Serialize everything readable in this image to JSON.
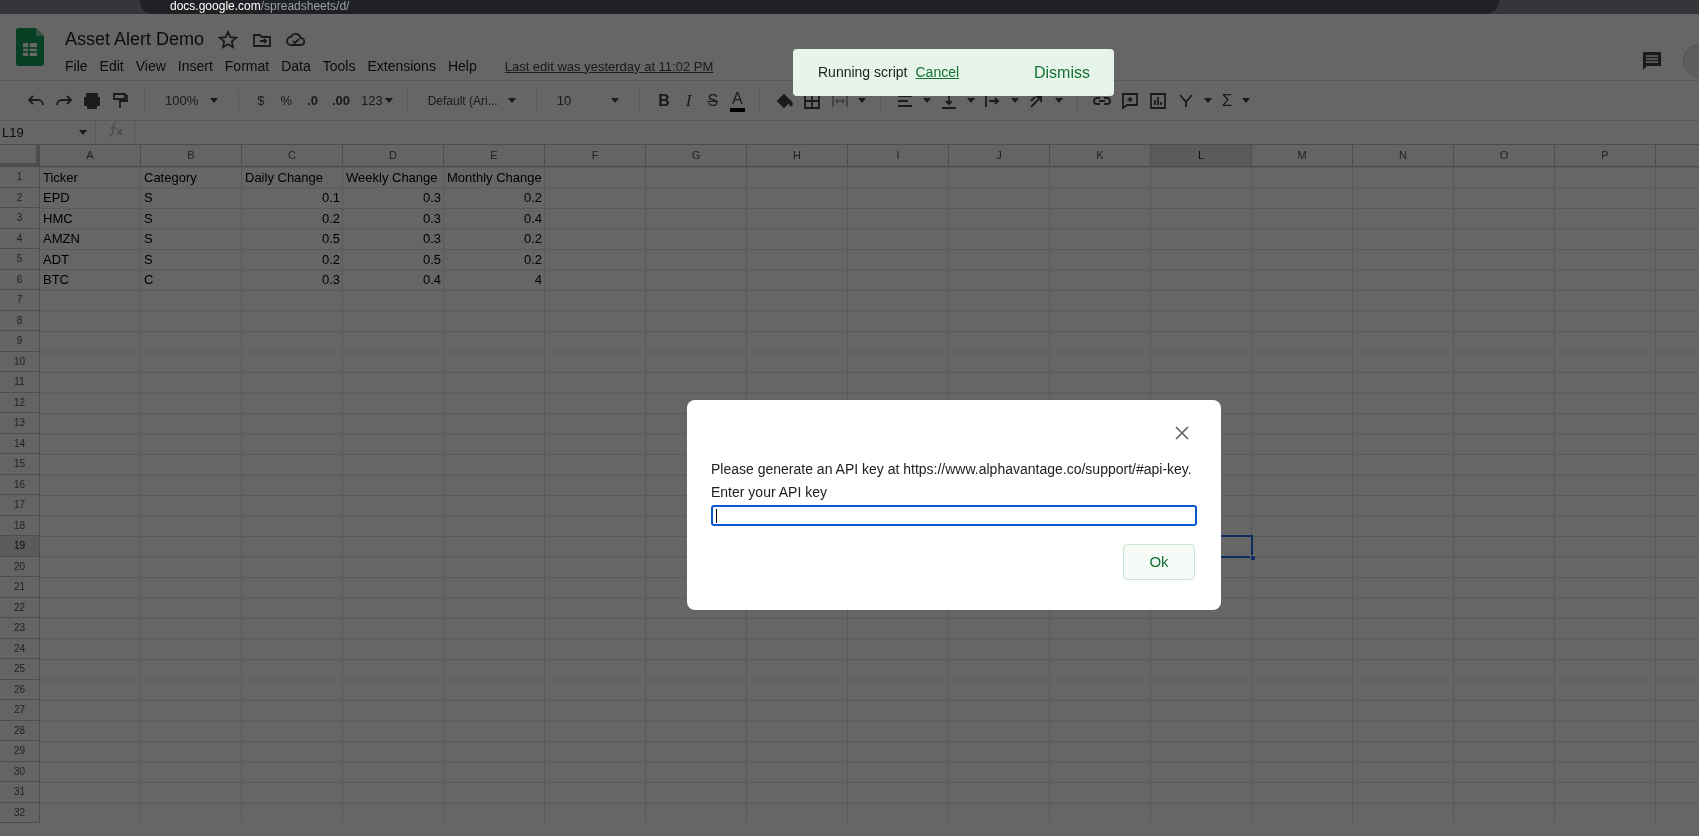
{
  "browser": {
    "url_host": "docs.google.com",
    "url_path": "/spreadsheets/d/"
  },
  "document": {
    "title": "Asset Alert Demo",
    "menu": [
      "File",
      "Edit",
      "View",
      "Insert",
      "Format",
      "Data",
      "Tools",
      "Extensions",
      "Help"
    ],
    "last_edit": "Last edit was yesterday at 11:02 PM"
  },
  "toolbar": {
    "zoom": "100%",
    "currency": "$",
    "percent": "%",
    "decrease_decimals": ".0",
    "increase_decimals": ".00",
    "number_format": "123",
    "font": "Default (Ari...",
    "font_size": "10",
    "bold": "B",
    "italic": "I",
    "strikethrough": "S",
    "text_color": "A",
    "functions": "Σ"
  },
  "name_box": "L19",
  "sheet": {
    "columns": [
      {
        "letter": "A",
        "selected": false
      },
      {
        "letter": "B",
        "selected": false
      },
      {
        "letter": "C",
        "selected": false
      },
      {
        "letter": "D",
        "selected": false
      },
      {
        "letter": "E",
        "selected": false
      },
      {
        "letter": "F",
        "selected": false
      },
      {
        "letter": "G",
        "selected": false
      },
      {
        "letter": "H",
        "selected": false
      },
      {
        "letter": "I",
        "selected": false
      },
      {
        "letter": "J",
        "selected": false
      },
      {
        "letter": "K",
        "selected": false
      },
      {
        "letter": "L",
        "selected": true
      },
      {
        "letter": "M",
        "selected": false
      },
      {
        "letter": "N",
        "selected": false
      },
      {
        "letter": "O",
        "selected": false
      },
      {
        "letter": "P",
        "selected": false
      }
    ],
    "rows": [
      {
        "number": "1",
        "selected": false,
        "cells": [
          {
            "text": "Ticker",
            "kind": "text"
          },
          {
            "text": "Category",
            "kind": "text"
          },
          {
            "text": "Daily Change",
            "kind": "text"
          },
          {
            "text": "Weekly Change",
            "kind": "text"
          },
          {
            "text": "Monthly Change",
            "kind": "text"
          }
        ]
      },
      {
        "number": "2",
        "selected": false,
        "cells": [
          {
            "text": "EPD",
            "kind": "text"
          },
          {
            "text": "S",
            "kind": "text"
          },
          {
            "text": "0.1",
            "kind": "number"
          },
          {
            "text": "0.3",
            "kind": "number"
          },
          {
            "text": "0.2",
            "kind": "number"
          }
        ]
      },
      {
        "number": "3",
        "selected": false,
        "cells": [
          {
            "text": "HMC",
            "kind": "text"
          },
          {
            "text": "S",
            "kind": "text"
          },
          {
            "text": "0.2",
            "kind": "number"
          },
          {
            "text": "0.3",
            "kind": "number"
          },
          {
            "text": "0.4",
            "kind": "number"
          }
        ]
      },
      {
        "number": "4",
        "selected": false,
        "cells": [
          {
            "text": "AMZN",
            "kind": "text"
          },
          {
            "text": "S",
            "kind": "text"
          },
          {
            "text": "0.5",
            "kind": "number"
          },
          {
            "text": "0.3",
            "kind": "number"
          },
          {
            "text": "0.2",
            "kind": "number"
          }
        ]
      },
      {
        "number": "5",
        "selected": false,
        "cells": [
          {
            "text": "ADT",
            "kind": "text"
          },
          {
            "text": "S",
            "kind": "text"
          },
          {
            "text": "0.2",
            "kind": "number"
          },
          {
            "text": "0.5",
            "kind": "number"
          },
          {
            "text": "0.2",
            "kind": "number"
          }
        ]
      },
      {
        "number": "6",
        "selected": false,
        "cells": [
          {
            "text": "BTC",
            "kind": "text"
          },
          {
            "text": "C",
            "kind": "text"
          },
          {
            "text": "0.3",
            "kind": "number"
          },
          {
            "text": "0.4",
            "kind": "number"
          },
          {
            "text": "4",
            "kind": "number"
          }
        ]
      },
      {
        "number": "7",
        "selected": false
      },
      {
        "number": "8",
        "selected": false
      },
      {
        "number": "9",
        "selected": false
      },
      {
        "number": "10",
        "selected": false
      },
      {
        "number": "11",
        "selected": false
      },
      {
        "number": "12",
        "selected": false
      },
      {
        "number": "13",
        "selected": false
      },
      {
        "number": "14",
        "selected": false
      },
      {
        "number": "15",
        "selected": false
      },
      {
        "number": "16",
        "selected": false
      },
      {
        "number": "17",
        "selected": false
      },
      {
        "number": "18",
        "selected": false
      },
      {
        "number": "19",
        "selected": true
      },
      {
        "number": "20",
        "selected": false
      },
      {
        "number": "21",
        "selected": false
      },
      {
        "number": "22",
        "selected": false
      },
      {
        "number": "23",
        "selected": false
      },
      {
        "number": "24",
        "selected": false
      },
      {
        "number": "25",
        "selected": false
      },
      {
        "number": "26",
        "selected": false
      },
      {
        "number": "27",
        "selected": false
      },
      {
        "number": "28",
        "selected": false
      },
      {
        "number": "29",
        "selected": false
      },
      {
        "number": "30",
        "selected": false
      },
      {
        "number": "31",
        "selected": false
      },
      {
        "number": "32",
        "selected": false
      }
    ]
  },
  "toast": {
    "message": "Running script",
    "cancel": "Cancel",
    "dismiss": "Dismiss"
  },
  "dialog": {
    "message": "Please generate an API key at https://www.alphavantage.co/support/#api-key.",
    "label": "Enter your API key",
    "ok": "Ok"
  }
}
